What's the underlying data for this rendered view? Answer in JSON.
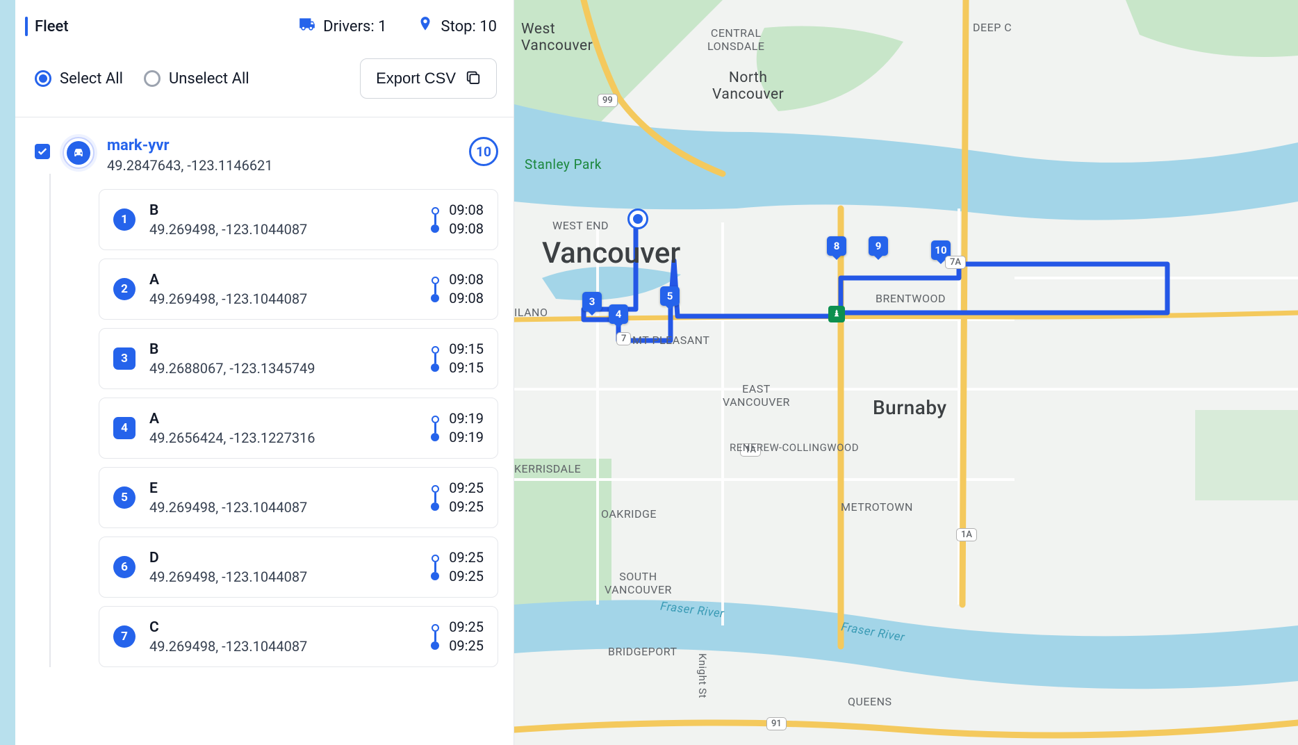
{
  "header": {
    "title": "Fleet",
    "drivers_label": "Drivers: 1",
    "stops_label": "Stop: 10"
  },
  "toolbar": {
    "select_all_label": "Select All",
    "unselect_all_label": "Unselect All",
    "export_label": "Export CSV"
  },
  "driver": {
    "name": "mark-yvr",
    "coords": "49.2847643, -123.1146621",
    "stop_count": "10",
    "stops": [
      {
        "num": "1",
        "shape": "round",
        "label": "B",
        "coords": "49.269498, -123.1044087",
        "t1": "09:08",
        "t2": "09:08"
      },
      {
        "num": "2",
        "shape": "round",
        "label": "A",
        "coords": "49.269498, -123.1044087",
        "t1": "09:08",
        "t2": "09:08"
      },
      {
        "num": "3",
        "shape": "square",
        "label": "B",
        "coords": "49.2688067, -123.1345749",
        "t1": "09:15",
        "t2": "09:15"
      },
      {
        "num": "4",
        "shape": "square",
        "label": "A",
        "coords": "49.2656424, -123.1227316",
        "t1": "09:19",
        "t2": "09:19"
      },
      {
        "num": "5",
        "shape": "round",
        "label": "E",
        "coords": "49.269498, -123.1044087",
        "t1": "09:25",
        "t2": "09:25"
      },
      {
        "num": "6",
        "shape": "round",
        "label": "D",
        "coords": "49.269498, -123.1044087",
        "t1": "09:25",
        "t2": "09:25"
      },
      {
        "num": "7",
        "shape": "round",
        "label": "C",
        "coords": "49.269498, -123.1044087",
        "t1": "09:25",
        "t2": "09:25"
      }
    ]
  },
  "map": {
    "labels": {
      "vancouver": "Vancouver",
      "burnaby": "Burnaby",
      "north_vancouver": "North\nVancouver",
      "west_vancouver": "West\nVancouver",
      "stanley_park": "Stanley Park",
      "west_end": "WEST END",
      "kitsilano": "ILANO",
      "mt_pleasant": "MT PLEASANT",
      "east_vancouver": "EAST\nVANCOUVER",
      "kerrisdale": "KERRISDALE",
      "oakridge": "OAKRIDGE",
      "south_vancouver": "SOUTH\nVANCOUVER",
      "bridgeport": "BRIDGEPORT",
      "knight_st": "Knight St",
      "fraser_river_w": "Fraser River",
      "fraser_river_e": "Fraser River",
      "central_lonsdale": "CENTRAL\nLONSDALE",
      "deep_c": "DEEP C",
      "brentwood": "BRENTWOOD",
      "renfrew": "RENFREW-COLLINGWOOD",
      "metrotown": "METROTOWN",
      "queens": "QUEENS"
    },
    "shields": [
      "99",
      "7",
      "1A",
      "1A",
      "7A",
      "91"
    ],
    "route_pins": [
      "3",
      "4",
      "5",
      "8",
      "9",
      "10"
    ]
  }
}
